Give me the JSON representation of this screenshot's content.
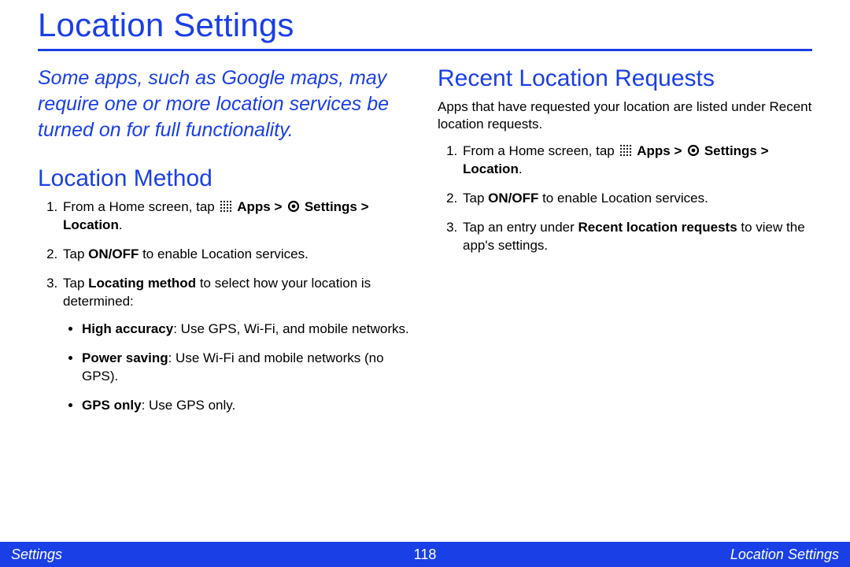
{
  "title": "Location Settings",
  "intro": "Some apps, such as Google maps, may require one or more location services be turned on for full functionality.",
  "left": {
    "heading": "Location Method",
    "steps": [
      {
        "pre": "From a Home screen, tap ",
        "hasIcons": true,
        "apps": "Apps",
        "sep1": " > ",
        "settings": "Settings",
        "sep2": " > ",
        "loc": "Location",
        "tail": "."
      },
      {
        "pre": "Tap ",
        "bold": "ON/OFF",
        "tail": " to enable Location services."
      },
      {
        "pre": "Tap ",
        "bold": "Locating method",
        "tail": " to select how your location is determined:"
      }
    ],
    "bullets": [
      {
        "bold": "High accuracy",
        "tail": ": Use GPS, Wi-Fi, and mobile networks."
      },
      {
        "bold": "Power saving",
        "tail": ": Use Wi-Fi and mobile networks (no GPS)."
      },
      {
        "bold": "GPS only",
        "tail": ": Use GPS only."
      }
    ]
  },
  "right": {
    "heading": "Recent Location Requests",
    "lead": "Apps that have requested your location are listed under Recent location requests.",
    "steps": [
      {
        "pre": "From a Home screen, tap ",
        "hasIcons": true,
        "apps": "Apps",
        "sep1": " > ",
        "settings": "Settings",
        "sep2": " > ",
        "loc": "Location",
        "tail": "."
      },
      {
        "pre": "Tap ",
        "bold": "ON/OFF",
        "tail": " to enable Location services."
      },
      {
        "pre": "Tap an entry under ",
        "bold": "Recent location requests",
        "tail": " to view the app's settings."
      }
    ]
  },
  "footer": {
    "left": "Settings",
    "page": "118",
    "right": "Location Settings"
  }
}
